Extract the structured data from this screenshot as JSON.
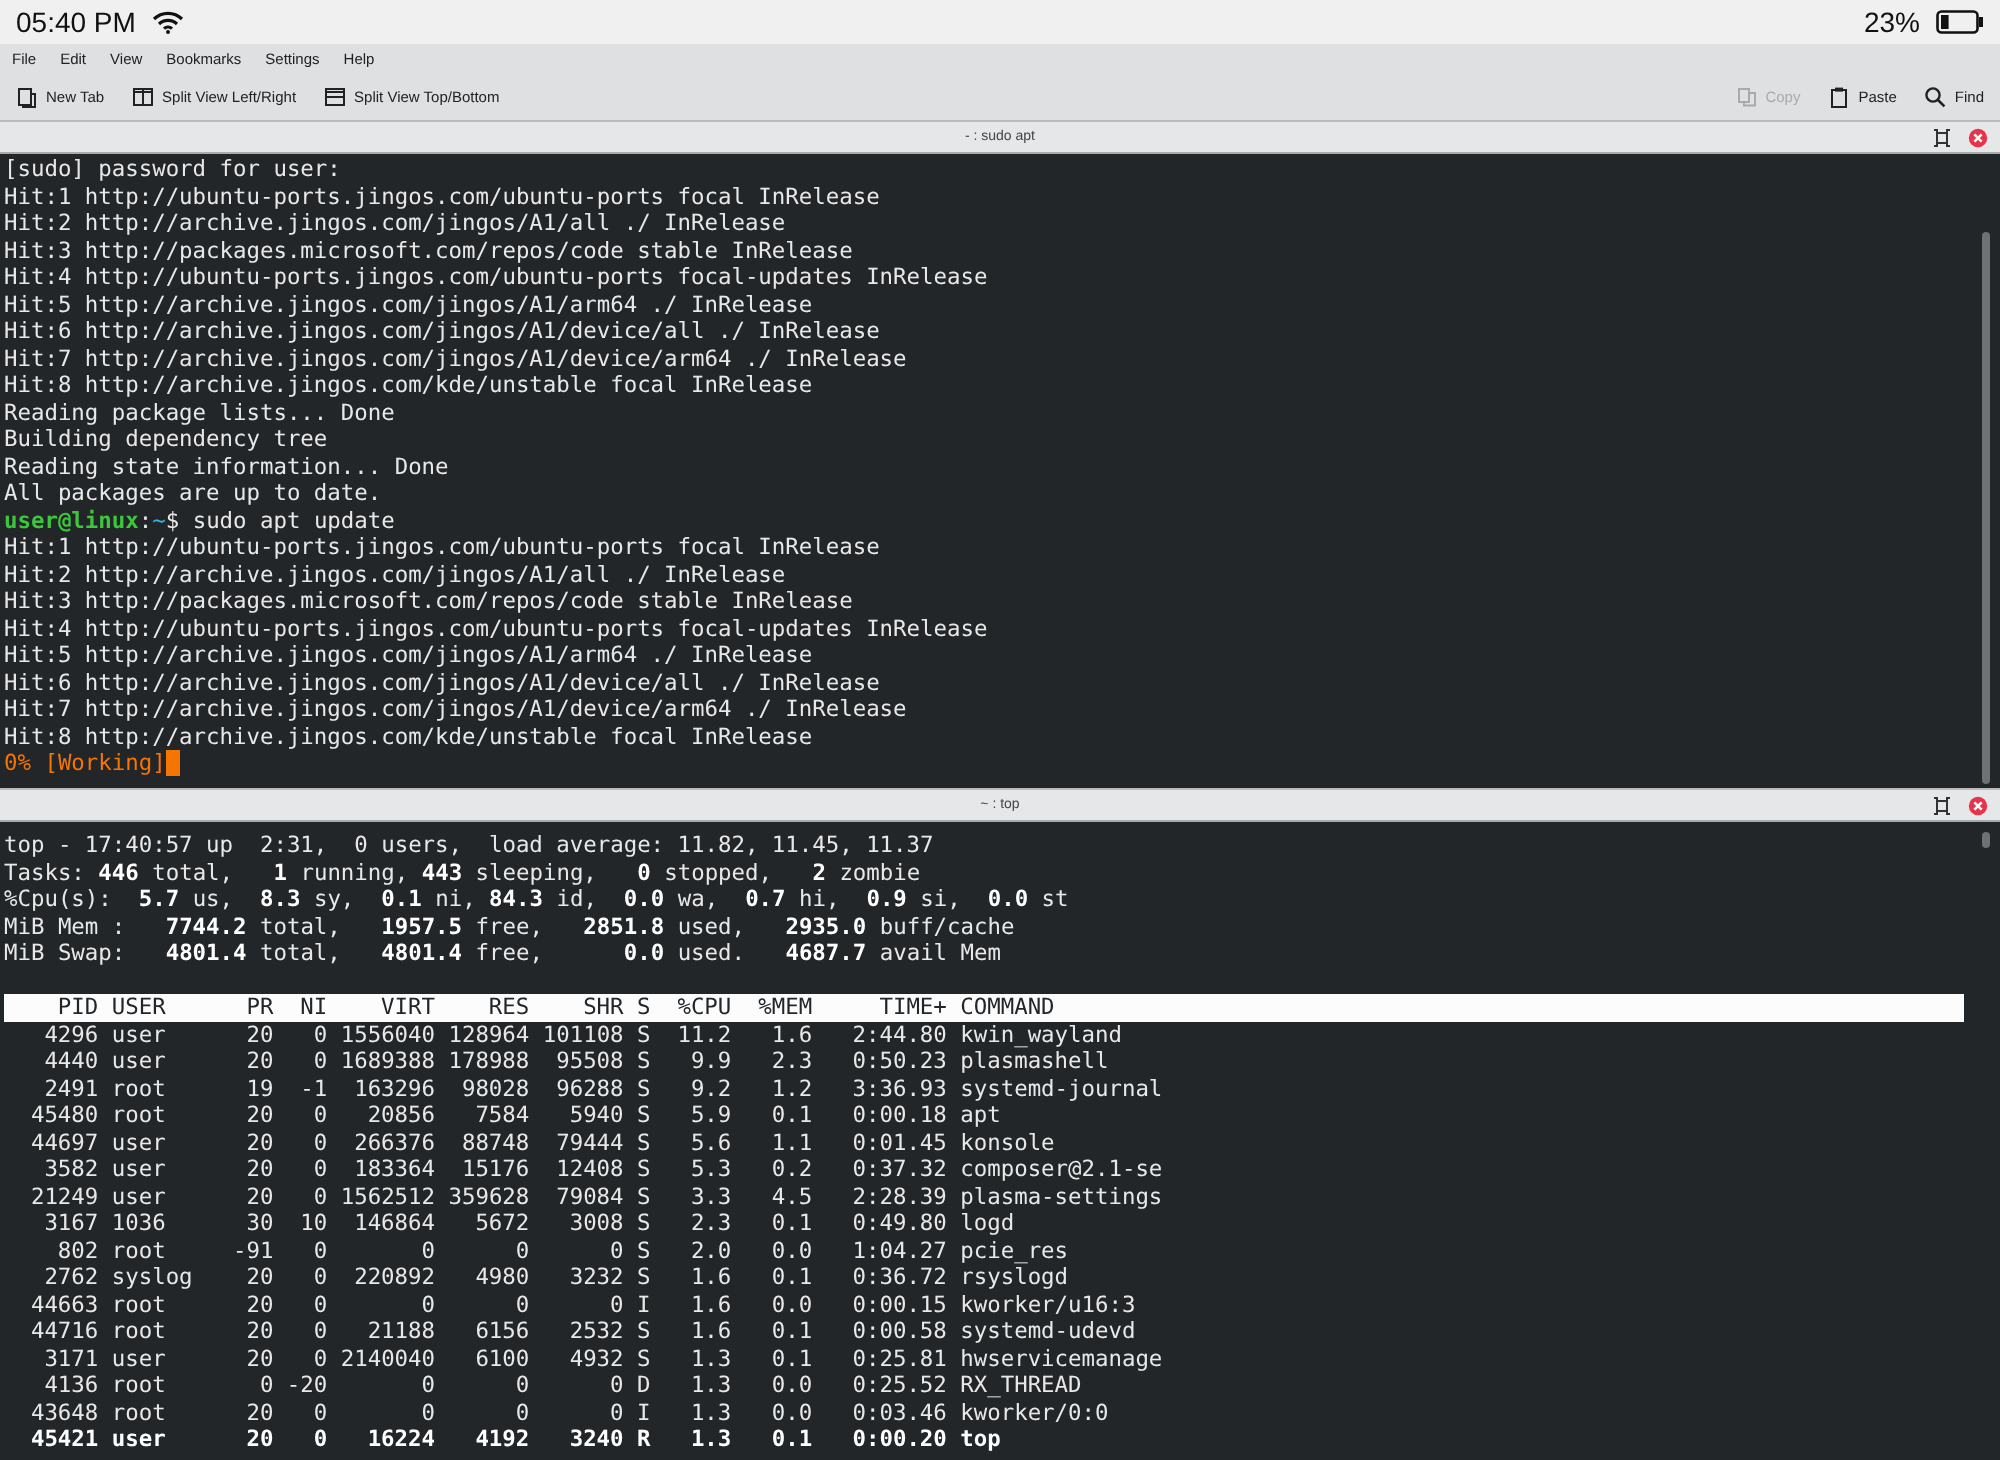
{
  "status_bar": {
    "time": "05:40 PM",
    "battery": "23%"
  },
  "menu": [
    "File",
    "Edit",
    "View",
    "Bookmarks",
    "Settings",
    "Help"
  ],
  "toolbar": {
    "left": [
      {
        "label": "New Tab",
        "kind": "new-tab",
        "disabled": false
      },
      {
        "label": "Split View Left/Right",
        "kind": "split-lr",
        "disabled": false
      },
      {
        "label": "Split View Top/Bottom",
        "kind": "split-tb",
        "disabled": false
      }
    ],
    "right": [
      {
        "label": "Copy",
        "kind": "copy",
        "disabled": true
      },
      {
        "label": "Paste",
        "kind": "paste",
        "disabled": false
      },
      {
        "label": "Find",
        "kind": "find",
        "disabled": false
      }
    ]
  },
  "panes": [
    {
      "title": "- : sudo apt",
      "kind": "log",
      "lines": [
        [
          {
            "text": "[sudo] password for user:",
            "kind": "plain"
          }
        ],
        [
          {
            "text": "Hit:1 http://ubuntu-ports.jingos.com/ubuntu-ports focal InRelease",
            "kind": "plain"
          }
        ],
        [
          {
            "text": "Hit:2 http://archive.jingos.com/jingos/A1/all ./ InRelease",
            "kind": "plain"
          }
        ],
        [
          {
            "text": "Hit:3 http://packages.microsoft.com/repos/code stable InRelease",
            "kind": "plain"
          }
        ],
        [
          {
            "text": "Hit:4 http://ubuntu-ports.jingos.com/ubuntu-ports focal-updates InRelease",
            "kind": "plain"
          }
        ],
        [
          {
            "text": "Hit:5 http://archive.jingos.com/jingos/A1/arm64 ./ InRelease",
            "kind": "plain"
          }
        ],
        [
          {
            "text": "Hit:6 http://archive.jingos.com/jingos/A1/device/all ./ InRelease",
            "kind": "plain"
          }
        ],
        [
          {
            "text": "Hit:7 http://archive.jingos.com/jingos/A1/device/arm64 ./ InRelease",
            "kind": "plain"
          }
        ],
        [
          {
            "text": "Hit:8 http://archive.jingos.com/kde/unstable focal InRelease",
            "kind": "plain"
          }
        ],
        [
          {
            "text": "Reading package lists... Done",
            "kind": "plain"
          }
        ],
        [
          {
            "text": "Building dependency tree",
            "kind": "plain"
          }
        ],
        [
          {
            "text": "Reading state information... Done",
            "kind": "plain"
          }
        ],
        [
          {
            "text": "All packages are up to date.",
            "kind": "plain"
          }
        ],
        [
          {
            "text": "user@linux",
            "kind": "user"
          },
          {
            "text": ":",
            "kind": "plain"
          },
          {
            "text": "~",
            "kind": "path"
          },
          {
            "text": "$ sudo apt update",
            "kind": "plain"
          }
        ],
        [
          {
            "text": "Hit:1 http://ubuntu-ports.jingos.com/ubuntu-ports focal InRelease",
            "kind": "plain"
          }
        ],
        [
          {
            "text": "Hit:2 http://archive.jingos.com/jingos/A1/all ./ InRelease",
            "kind": "plain"
          }
        ],
        [
          {
            "text": "Hit:3 http://packages.microsoft.com/repos/code stable InRelease",
            "kind": "plain"
          }
        ],
        [
          {
            "text": "Hit:4 http://ubuntu-ports.jingos.com/ubuntu-ports focal-updates InRelease",
            "kind": "plain"
          }
        ],
        [
          {
            "text": "Hit:5 http://archive.jingos.com/jingos/A1/arm64 ./ InRelease",
            "kind": "plain"
          }
        ],
        [
          {
            "text": "Hit:6 http://archive.jingos.com/jingos/A1/device/all ./ InRelease",
            "kind": "plain"
          }
        ],
        [
          {
            "text": "Hit:7 http://archive.jingos.com/jingos/A1/device/arm64 ./ InRelease",
            "kind": "plain"
          }
        ],
        [
          {
            "text": "Hit:8 http://archive.jingos.com/kde/unstable focal InRelease",
            "kind": "plain"
          }
        ],
        [
          {
            "text": "0% [Working]",
            "kind": "progress",
            "cursor": true
          }
        ]
      ]
    },
    {
      "title": "~ : top",
      "kind": "top",
      "summary": [
        "top - 17:40:57 up  2:31,  0 users,  load average: 11.82, 11.45, 11.37",
        "Tasks: **446** total,   **1** running, **443** sleeping,   **0** stopped,   **2** zombie",
        "%Cpu(s):  **5.7** us,  **8.3** sy,  **0.1** ni, **84.3** id,  **0.0** wa,  **0.7** hi,  **0.9** si,  **0.0** st",
        "MiB Mem :   **7744.2** total,   **1957.5** free,   **2851.8** used,   **2935.0** buff/cache",
        "MiB Swap:   **4801.4** total,   **4801.4** free,      **0.0** used.   **4687.7** avail Mem"
      ],
      "columns": [
        "PID",
        "USER",
        "PR",
        "NI",
        "VIRT",
        "RES",
        "SHR",
        "S",
        "%CPU",
        "%MEM",
        "TIME+",
        "COMMAND"
      ],
      "rows": [
        {
          "highlighted": false,
          "cells": [
            "4296",
            "user",
            "20",
            "0",
            "1556040",
            "128964",
            "101108",
            "S",
            "11.2",
            "1.6",
            "2:44.80",
            "kwin_wayland"
          ]
        },
        {
          "highlighted": false,
          "cells": [
            "4440",
            "user",
            "20",
            "0",
            "1689388",
            "178988",
            "95508",
            "S",
            "9.9",
            "2.3",
            "0:50.23",
            "plasmashell"
          ]
        },
        {
          "highlighted": false,
          "cells": [
            "2491",
            "root",
            "19",
            "-1",
            "163296",
            "98028",
            "96288",
            "S",
            "9.2",
            "1.2",
            "3:36.93",
            "systemd-journal"
          ]
        },
        {
          "highlighted": false,
          "cells": [
            "45480",
            "root",
            "20",
            "0",
            "20856",
            "7584",
            "5940",
            "S",
            "5.9",
            "0.1",
            "0:00.18",
            "apt"
          ]
        },
        {
          "highlighted": false,
          "cells": [
            "44697",
            "user",
            "20",
            "0",
            "266376",
            "88748",
            "79444",
            "S",
            "5.6",
            "1.1",
            "0:01.45",
            "konsole"
          ]
        },
        {
          "highlighted": false,
          "cells": [
            "3582",
            "user",
            "20",
            "0",
            "183364",
            "15176",
            "12408",
            "S",
            "5.3",
            "0.2",
            "0:37.32",
            "composer@2.1-se"
          ]
        },
        {
          "highlighted": false,
          "cells": [
            "21249",
            "user",
            "20",
            "0",
            "1562512",
            "359628",
            "79084",
            "S",
            "3.3",
            "4.5",
            "2:28.39",
            "plasma-settings"
          ]
        },
        {
          "highlighted": false,
          "cells": [
            "3167",
            "1036",
            "30",
            "10",
            "146864",
            "5672",
            "3008",
            "S",
            "2.3",
            "0.1",
            "0:49.80",
            "logd"
          ]
        },
        {
          "highlighted": false,
          "cells": [
            "802",
            "root",
            "-91",
            "0",
            "0",
            "0",
            "0",
            "S",
            "2.0",
            "0.0",
            "1:04.27",
            "pcie_res"
          ]
        },
        {
          "highlighted": false,
          "cells": [
            "2762",
            "syslog",
            "20",
            "0",
            "220892",
            "4980",
            "3232",
            "S",
            "1.6",
            "0.1",
            "0:36.72",
            "rsyslogd"
          ]
        },
        {
          "highlighted": false,
          "cells": [
            "44663",
            "root",
            "20",
            "0",
            "0",
            "0",
            "0",
            "I",
            "1.6",
            "0.0",
            "0:00.15",
            "kworker/u16:3"
          ]
        },
        {
          "highlighted": false,
          "cells": [
            "44716",
            "root",
            "20",
            "0",
            "21188",
            "6156",
            "2532",
            "S",
            "1.6",
            "0.1",
            "0:00.58",
            "systemd-udevd"
          ]
        },
        {
          "highlighted": false,
          "cells": [
            "3171",
            "user",
            "20",
            "0",
            "2140040",
            "6100",
            "4932",
            "S",
            "1.3",
            "0.1",
            "0:25.81",
            "hwservicemanage"
          ]
        },
        {
          "highlighted": false,
          "cells": [
            "4136",
            "root",
            "0",
            "-20",
            "0",
            "0",
            "0",
            "D",
            "1.3",
            "0.0",
            "0:25.52",
            "RX_THREAD"
          ]
        },
        {
          "highlighted": false,
          "cells": [
            "43648",
            "root",
            "20",
            "0",
            "0",
            "0",
            "0",
            "I",
            "1.3",
            "0.0",
            "0:03.46",
            "kworker/0:0"
          ]
        },
        {
          "highlighted": true,
          "cells": [
            "45421",
            "user",
            "20",
            "0",
            "16224",
            "4192",
            "3240",
            "R",
            "1.3",
            "0.1",
            "0:00.20",
            "top"
          ]
        }
      ]
    }
  ]
}
